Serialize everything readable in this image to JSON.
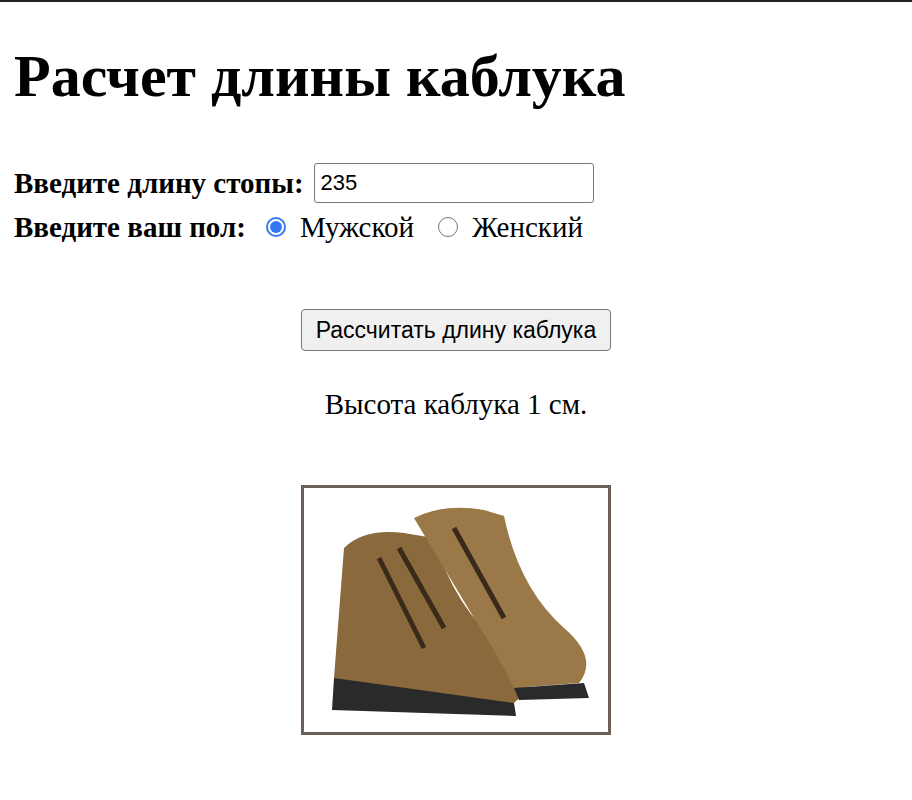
{
  "title": "Расчет длины каблука",
  "foot": {
    "label": "Введите длину стопы:",
    "value": "235"
  },
  "gender": {
    "label": "Введите ваш пол:",
    "options": [
      {
        "label": "Мужской",
        "selected": true
      },
      {
        "label": "Женский",
        "selected": false
      }
    ]
  },
  "button": "Рассчитать длину каблука",
  "result": "Высота каблука 1 см."
}
